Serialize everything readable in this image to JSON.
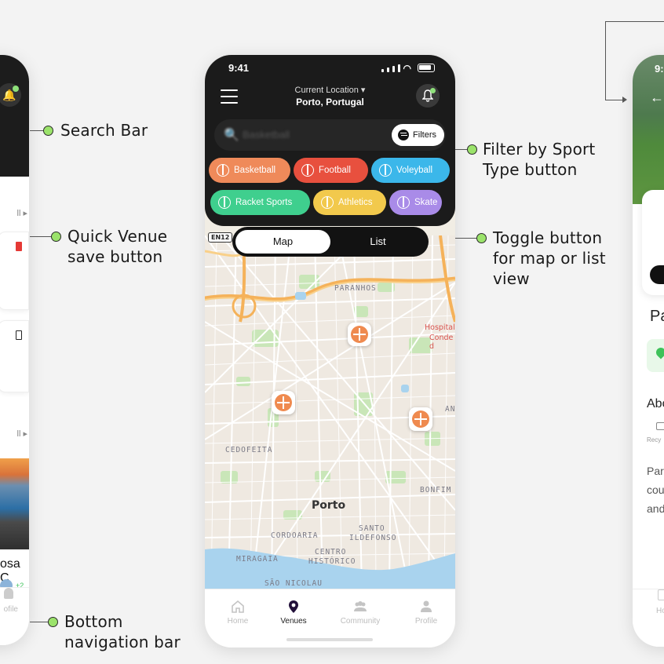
{
  "annotations": {
    "search_bar": "Search Bar",
    "quick_save_1": "Quick Venue",
    "quick_save_2": "save button",
    "filter_1": "Filter by Sport",
    "filter_2": "Type button",
    "toggle_1": "Toggle button",
    "toggle_2": "for map or list",
    "toggle_3": "view",
    "bottom_nav_1": "Bottom",
    "bottom_nav_2": "navigation bar"
  },
  "colors": {
    "dot": "#9be36b",
    "basketball": "#ef8a5a",
    "football": "#e8503e",
    "volleyball": "#3bb7ea",
    "racket": "#3fcf8e",
    "athletics": "#f2c94c",
    "skate": "#a98be8",
    "pin": "#ef8a4f"
  },
  "main": {
    "status_time": "9:41",
    "location_label": "Current Location",
    "location_value": "Porto, Portugal",
    "search_placeholder": "Basketball",
    "filters_label": "Filters",
    "chips": [
      {
        "label": "Basketball",
        "icon": "basketball-icon"
      },
      {
        "label": "Football",
        "icon": "football-icon"
      },
      {
        "label": "Voleyball",
        "icon": "volleyball-icon"
      },
      {
        "label": "Racket Sports",
        "icon": "racket-icon"
      },
      {
        "label": "Athletics",
        "icon": "running-icon"
      },
      {
        "label": "Skate",
        "icon": "skate-icon"
      }
    ],
    "toggle": {
      "map": "Map",
      "list": "List",
      "selected": "Map"
    },
    "road_badge": "EN12",
    "map_labels": {
      "paranhos": "PARANHOS",
      "hospital_1": "Hospital",
      "hospital_2": "Conde d",
      "cedofeita": "CEDOFEITA",
      "porto": "Porto",
      "bonfim": "BONFIM",
      "santo_1": "SANTO",
      "santo_2": "ILDEFONSO",
      "cordoaria": "CORDOARIA",
      "centro_1": "CENTRO",
      "centro_2": "HISTÓRICO",
      "miragaia": "MIRAGAIA",
      "sao_nicolau": "SÃO NICOLAU",
      "an": "AN"
    },
    "nav": [
      {
        "label": "Home",
        "icon": "home-icon"
      },
      {
        "label": "Venues",
        "icon": "location-pin-icon"
      },
      {
        "label": "Community",
        "icon": "community-icon"
      },
      {
        "label": "Profile",
        "icon": "profile-icon"
      }
    ],
    "active_nav": "Venues"
  },
  "left": {
    "see_all_1": "ll ▸",
    "see_all_2": "ll ▸",
    "venue_name": "osa C",
    "avatars_more": "+2",
    "nav_label": "ofile"
  },
  "right": {
    "time": "9:",
    "title": "Pa",
    "about": "Abo",
    "amenity": "Recy",
    "text_1": "Par",
    "text_2": "cou",
    "text_3": "and",
    "nav_label": "Ho"
  }
}
